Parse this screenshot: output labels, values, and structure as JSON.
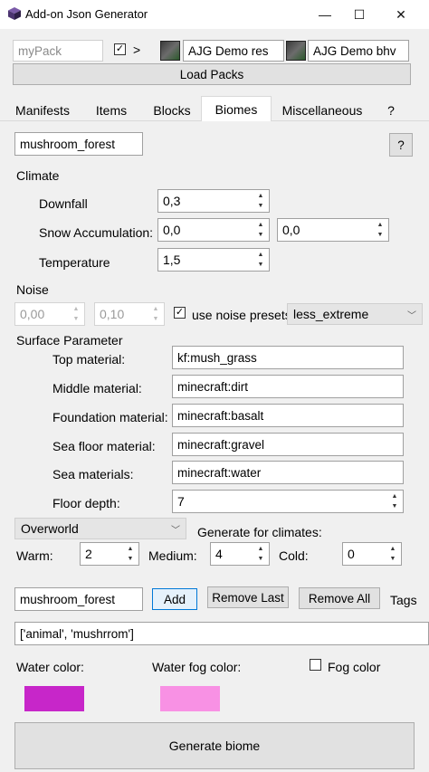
{
  "window": {
    "title": "Add-on Json Generator",
    "minimize": "—",
    "maximize": "☐",
    "close": "✕"
  },
  "packs": {
    "name_placeholder": "myPack",
    "checked": true,
    "arrow": ">",
    "res_pack": "AJG Demo res",
    "bhv_pack": "AJG Demo bhv",
    "load_label": "Load Packs"
  },
  "tabs": [
    {
      "label": "Manifests"
    },
    {
      "label": "Items"
    },
    {
      "label": "Blocks"
    },
    {
      "label": "Biomes"
    },
    {
      "label": "Miscellaneous"
    },
    {
      "label": "?"
    }
  ],
  "biome": {
    "name": "mushroom_forest",
    "help_label": "?",
    "climate_label": "Climate",
    "downfall_label": "Downfall",
    "downfall": "0,3",
    "snow_label": "Snow Accumulation:",
    "snow_min": "0,0",
    "snow_max": "0,0",
    "temperature_label": "Temperature",
    "temperature": "1,5",
    "noise_label": "Noise",
    "noise_a": "0,00",
    "noise_b": "0,10",
    "use_presets_label": "use noise presets",
    "use_presets_checked": true,
    "preset": "less_extreme",
    "surface_label": "Surface Parameter",
    "top_label": "Top material:",
    "top": "kf:mush_grass",
    "middle_label": "Middle material:",
    "middle": "minecraft:dirt",
    "foundation_label": "Foundation material:",
    "foundation": "minecraft:basalt",
    "seafloor_label": "Sea floor material:",
    "seafloor": "minecraft:gravel",
    "sea_label": "Sea materials:",
    "sea": "minecraft:water",
    "floor_depth_label": "Floor depth:",
    "floor_depth": "7",
    "dimension": "Overworld",
    "generate_climates_label": "Generate for climates:",
    "warm_label": "Warm:",
    "warm": "2",
    "medium_label": "Medium:",
    "medium": "4",
    "cold_label": "Cold:",
    "cold": "0",
    "tag_input": "mushroom_forest",
    "add_label": "Add",
    "remove_last_label": "Remove Last",
    "remove_all_label": "Remove All",
    "tags_label": "Tags",
    "tags_value": "['animal', 'mushrrom']",
    "water_color_label": "Water color:",
    "water_color": "#c726c9",
    "water_fog_label": "Water fog color:",
    "water_fog_color": "#f891e4",
    "fog_color_label": "Fog color",
    "fog_color_checked": false,
    "generate_label": "Generate biome"
  }
}
